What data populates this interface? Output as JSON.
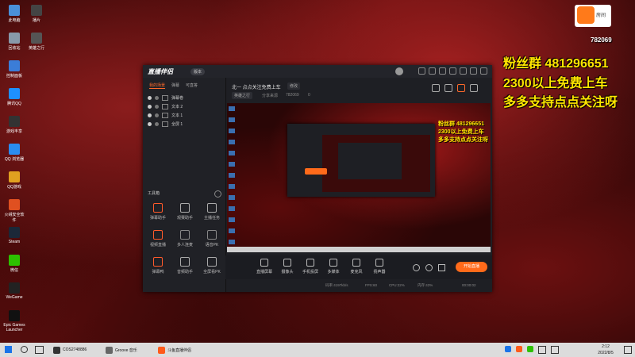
{
  "desktop_icons": [
    {
      "label": "此电脑",
      "color": "#4a90d9"
    },
    {
      "label": "回收站",
      "color": "#8899aa"
    },
    {
      "label": "控制面板",
      "color": "#3b7dd8"
    },
    {
      "label": "腾讯QQ",
      "color": "#1e90ff"
    },
    {
      "label": "游戏丰享",
      "color": "#333333"
    },
    {
      "label": "QQ 浏览器",
      "color": "#2a8cf0"
    },
    {
      "label": "QQ游戏",
      "color": "#e0a020"
    },
    {
      "label": "火绒安全软件",
      "color": "#e05020"
    },
    {
      "label": "Steam",
      "color": "#1b2838"
    },
    {
      "label": "微信",
      "color": "#2dc100"
    },
    {
      "label": "WeGame",
      "color": "#222222"
    },
    {
      "label": "Epic Games Launcher",
      "color": "#111111"
    }
  ],
  "desktop_icons_col2": [
    {
      "label": "播片",
      "color": "#444444"
    },
    {
      "label": "英雄之行",
      "color": "#555555"
    }
  ],
  "overlay": {
    "line1": "粉丝群 481296651",
    "line2": "2300以上免费上车",
    "line3": "多多支持点点关注呀",
    "room_label": "房间",
    "room_number": "782069"
  },
  "window": {
    "app_name": "直播伴侣",
    "version_badge": "版本",
    "sidebar_tabs": [
      "我的场景",
      "弹幕",
      "可直答"
    ],
    "sources": [
      {
        "label": "弹幕卷"
      },
      {
        "label": "文本 2"
      },
      {
        "label": "文本 1"
      },
      {
        "label": "全屏 1"
      }
    ],
    "tools_header": "工具箱",
    "tools": [
      {
        "label": "弹幕助手",
        "color": "#ff5a2a"
      },
      {
        "label": "观赛助手",
        "color": "#aaaaaa"
      },
      {
        "label": "主播任务",
        "color": "#aaaaaa"
      },
      {
        "label": "视频直播",
        "color": "#ff5a2a"
      },
      {
        "label": "多人连麦",
        "color": "#888888"
      },
      {
        "label": "语音PK",
        "color": "#888888"
      },
      {
        "label": "弹幕鸭",
        "color": "#ff5a2a"
      },
      {
        "label": "音频助手",
        "color": "#aaaaaa"
      },
      {
        "label": "全屏看PK",
        "color": "#aaaaaa"
      }
    ],
    "stream_title": "北一 点点关注免费上车",
    "edit_label": "修改",
    "category_tag": "英雄之行",
    "subtitle": "分享来源",
    "room_id": "782069",
    "likes": "0",
    "bottom_controls": [
      {
        "label": "直播屏幕"
      },
      {
        "label": "摄像头"
      },
      {
        "label": "手机投屏"
      },
      {
        "label": "多媒体"
      },
      {
        "label": "麦克风"
      },
      {
        "label": "扬声器"
      }
    ],
    "start_button": "开始直播",
    "status": {
      "bitrate": "码率:4197kb/s",
      "fps": "FPS:60",
      "cpu": "CPU:22%",
      "mem": "内存:43%",
      "time": "00:00:02"
    }
  },
  "taskbar": {
    "items": [
      {
        "label": "COS2748886",
        "color": "#333333"
      },
      {
        "label": "Groove 音乐",
        "color": "#666666"
      },
      {
        "label": "斗鱼直播伴侣",
        "color": "#ff5a1a"
      }
    ],
    "time": "2:12",
    "date": "2022/8/5"
  }
}
